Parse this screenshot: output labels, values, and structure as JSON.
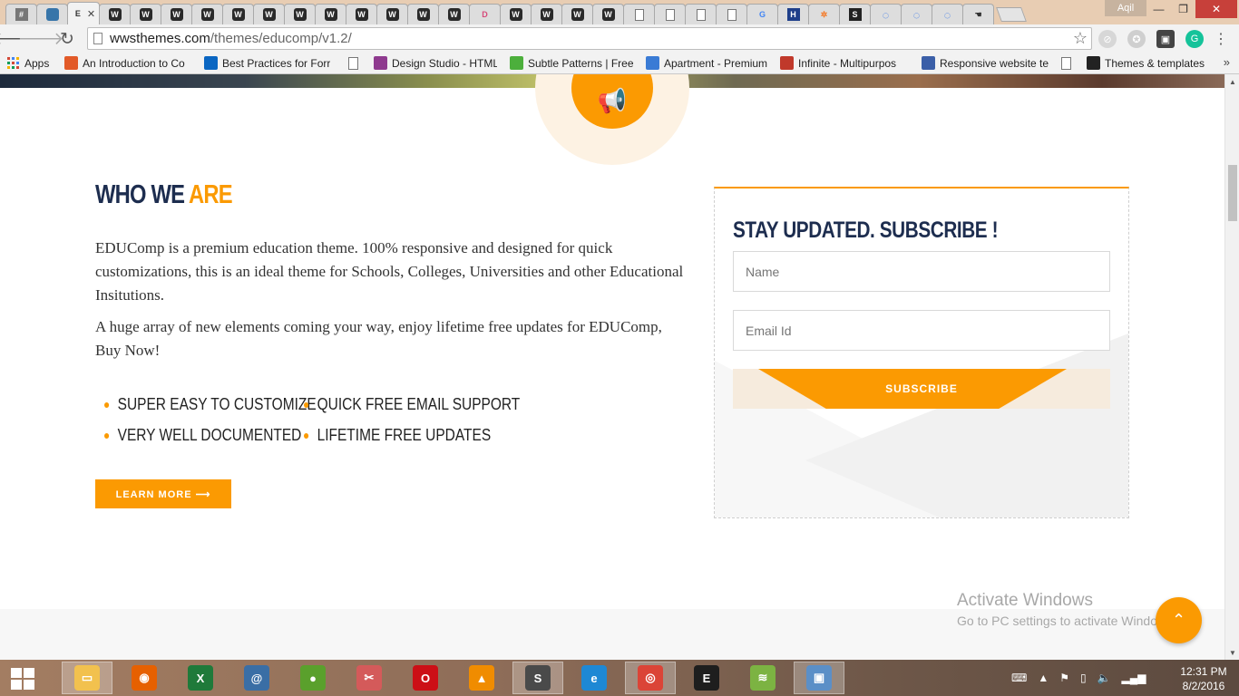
{
  "browser": {
    "tabs": [
      {
        "icon": "hash-icon",
        "label": "#"
      },
      {
        "icon": "python-icon",
        "label": ""
      },
      {
        "icon": "none",
        "label": "E",
        "active": true
      },
      {
        "icon": "w-icon",
        "label": "W"
      },
      {
        "icon": "w-icon",
        "label": "W"
      },
      {
        "icon": "w-icon",
        "label": "W"
      },
      {
        "icon": "w-icon",
        "label": "W"
      },
      {
        "icon": "w-icon",
        "label": "W"
      },
      {
        "icon": "w-icon",
        "label": "W"
      },
      {
        "icon": "w-icon",
        "label": "W"
      },
      {
        "icon": "w-icon",
        "label": "W"
      },
      {
        "icon": "w-icon",
        "label": "W"
      },
      {
        "icon": "w-icon",
        "label": "W"
      },
      {
        "icon": "w-icon",
        "label": "W"
      },
      {
        "icon": "w-icon",
        "label": "W"
      },
      {
        "icon": "d-icon",
        "label": "D"
      },
      {
        "icon": "w-icon",
        "label": "W"
      },
      {
        "icon": "w-icon",
        "label": "W"
      },
      {
        "icon": "w-icon",
        "label": "W"
      },
      {
        "icon": "w-icon",
        "label": "W"
      },
      {
        "icon": "document-icon",
        "label": ""
      },
      {
        "icon": "document-icon",
        "label": ""
      },
      {
        "icon": "document-icon",
        "label": ""
      },
      {
        "icon": "document-icon",
        "label": ""
      },
      {
        "icon": "google-icon",
        "label": "G"
      },
      {
        "icon": "h-icon",
        "label": "H"
      },
      {
        "icon": "hubspot-icon",
        "label": "✲"
      },
      {
        "icon": "s-icon",
        "label": "S"
      },
      {
        "icon": "loading-icon",
        "label": "◌"
      },
      {
        "icon": "loading-icon",
        "label": "◌"
      },
      {
        "icon": "loading-icon",
        "label": "◌"
      },
      {
        "icon": "hand-icon",
        "label": "☚"
      }
    ],
    "user": "Aqil",
    "url_host": "wwsthemes.com",
    "url_path": "/themes/educomp/v1.2/",
    "bookmarks": [
      {
        "icon": "apps-icon",
        "label": "Apps",
        "color": "#d34836"
      },
      {
        "icon": "plus-icon",
        "label": "An Introduction to Co",
        "color": "#e25a28"
      },
      {
        "icon": "linkedin-icon",
        "label": "Best Practices for Forr",
        "color": "#0a66c2"
      },
      {
        "icon": "document-icon",
        "label": "",
        "color": "#ffffff"
      },
      {
        "icon": "d-icon",
        "label": "Design Studio - HTML",
        "color": "#8e3a8e"
      },
      {
        "icon": "subtle-icon",
        "label": "Subtle Patterns | Free",
        "color": "#4caf3c"
      },
      {
        "icon": "home-icon",
        "label": "Apartment - Premium",
        "color": "#3a7bd5"
      },
      {
        "icon": "wp-icon",
        "label": "Infinite - Multipurpos",
        "color": "#c0392b"
      },
      {
        "icon": "shield-icon",
        "label": "Responsive website te",
        "color": "#3b5fa8"
      },
      {
        "icon": "document-icon",
        "label": "",
        "color": "#ffffff"
      },
      {
        "icon": "w-icon",
        "label": "Themes & templates",
        "color": "#222222"
      }
    ]
  },
  "page": {
    "who_title_main": "WHO WE ",
    "who_title_accent": "ARE",
    "para1": "EDUComp is a premium education theme. 100% responsive and designed for quick customizations, this is an ideal theme for Schools, Colleges, Universities and other Educational Insitutions.",
    "para2": "A huge array of new elements coming your way, enjoy lifetime free updates for EDUComp, Buy Now!",
    "features": [
      "SUPER EASY TO CUSTOMIZE",
      "QUICK FREE EMAIL SUPPORT",
      "VERY WELL DOCUMENTED",
      "LIFETIME FREE UPDATES"
    ],
    "learn_more": "LEARN MORE ⟶",
    "subscribe": {
      "title": "STAY UPDATED. SUBSCRIBE !",
      "name_placeholder": "Name",
      "email_placeholder": "Email Id",
      "button": "SUBSCRIBE"
    },
    "accent_color": "#fb9a02",
    "navy_color": "#1d2d4f",
    "back_to_top": "⌃"
  },
  "windows": {
    "activate_title": "Activate Windows",
    "activate_sub": "Go to PC settings to activate Windows.",
    "clock_time": "12:31 PM",
    "clock_date": "8/2/2016",
    "taskbar_apps": [
      {
        "name": "file-explorer-icon",
        "glyph": "▭",
        "color": "#f2c14e",
        "active": true
      },
      {
        "name": "firefox-icon",
        "glyph": "◉",
        "color": "#e66000",
        "active": false
      },
      {
        "name": "excel-icon",
        "glyph": "X",
        "color": "#1f7a3a",
        "active": false
      },
      {
        "name": "email-icon",
        "glyph": "@",
        "color": "#3a6ea5",
        "active": false
      },
      {
        "name": "frog-icon",
        "glyph": "●",
        "color": "#5aa02c",
        "active": false
      },
      {
        "name": "scissors-icon",
        "glyph": "✂",
        "color": "#d45a5a",
        "active": false
      },
      {
        "name": "opera-icon",
        "glyph": "O",
        "color": "#cc0f16",
        "active": false
      },
      {
        "name": "vlc-icon",
        "glyph": "▲",
        "color": "#f08c00",
        "active": false
      },
      {
        "name": "sublime-icon",
        "glyph": "S",
        "color": "#4a4a4a",
        "active": true
      },
      {
        "name": "ie-icon",
        "glyph": "e",
        "color": "#1e88d4",
        "active": false
      },
      {
        "name": "chrome-icon",
        "glyph": "◎",
        "color": "#db4437",
        "active": true
      },
      {
        "name": "terminal-icon",
        "glyph": "E",
        "color": "#1e1e1e",
        "active": false
      },
      {
        "name": "bluestacks-icon",
        "glyph": "≋",
        "color": "#7cb342",
        "active": false
      },
      {
        "name": "photo-icon",
        "glyph": "▣",
        "color": "#5b8fc7",
        "active": true
      }
    ]
  }
}
